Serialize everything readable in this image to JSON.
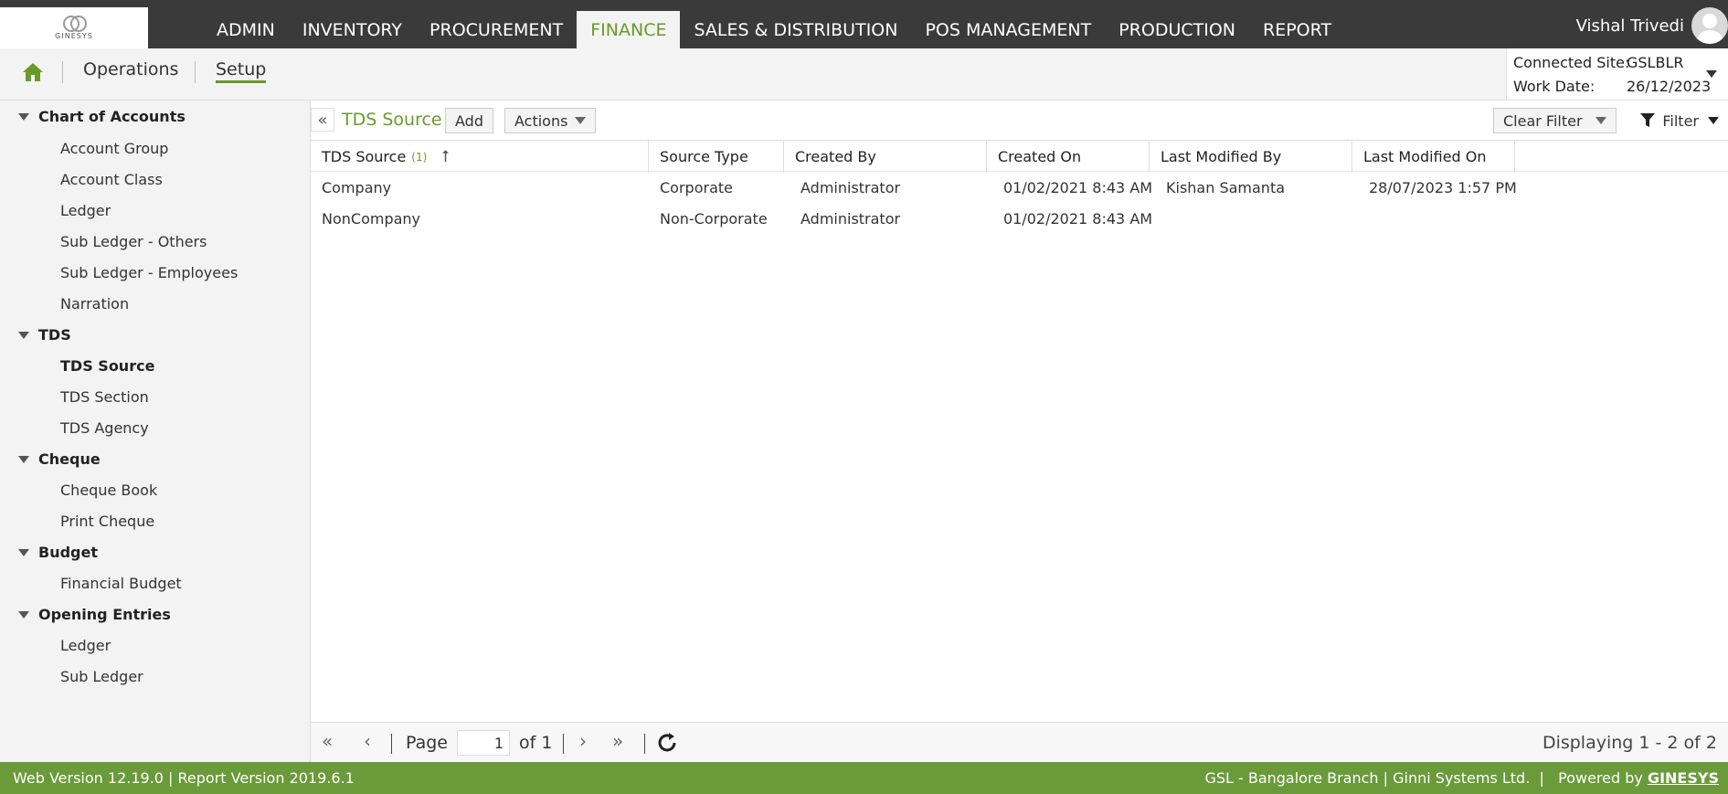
{
  "logo": {
    "text": "GINESYS"
  },
  "nav": {
    "items": [
      {
        "label": "ADMIN"
      },
      {
        "label": "INVENTORY"
      },
      {
        "label": "PROCUREMENT"
      },
      {
        "label": "FINANCE",
        "active": true
      },
      {
        "label": "SALES & DISTRIBUTION"
      },
      {
        "label": "POS MANAGEMENT"
      },
      {
        "label": "PRODUCTION"
      },
      {
        "label": "REPORT"
      }
    ]
  },
  "user": {
    "name": "Vishal Trivedi"
  },
  "subnav": {
    "operations": "Operations",
    "setup": "Setup"
  },
  "site": {
    "connected_label": "Connected Site:",
    "connected_value": "GSLBLR",
    "workdate_label": "Work Date:",
    "workdate_value": "26/12/2023"
  },
  "sidebar": {
    "groups": [
      {
        "label": "Chart of Accounts",
        "items": [
          "Account Group",
          "Account Class",
          "Ledger",
          "Sub Ledger - Others",
          "Sub Ledger - Employees",
          "Narration"
        ]
      },
      {
        "label": "TDS",
        "items": [
          "TDS Source",
          "TDS Section",
          "TDS Agency"
        ]
      },
      {
        "label": "Cheque",
        "items": [
          "Cheque Book",
          "Print Cheque"
        ]
      },
      {
        "label": "Budget",
        "items": [
          "Financial Budget"
        ]
      },
      {
        "label": "Opening Entries",
        "items": [
          "Ledger",
          "Sub Ledger"
        ]
      }
    ],
    "active_item": "TDS Source"
  },
  "toolbar": {
    "title": "TDS Source",
    "add_label": "Add",
    "actions_label": "Actions",
    "clear_filter_label": "Clear Filter",
    "filter_label": "Filter"
  },
  "grid": {
    "columns": [
      "TDS Source",
      "Source Type",
      "Created By",
      "Created On",
      "Last Modified By",
      "Last Modified On"
    ],
    "sort_count": "(1)",
    "rows": [
      [
        "Company",
        "Corporate",
        "Administrator",
        "01/02/2021 8:43 AM",
        "Kishan Samanta",
        "28/07/2023 1:57 PM"
      ],
      [
        "NonCompany",
        "Non-Corporate",
        "Administrator",
        "01/02/2021 8:43 AM",
        "",
        ""
      ]
    ]
  },
  "pager": {
    "page_label": "Page",
    "page_value": "1",
    "of_label": "of 1",
    "display_text": "Displaying 1 - 2 of 2"
  },
  "footer": {
    "left": "Web Version 12.19.0 | Report Version 2019.6.1",
    "right": "GSL - Bangalore Branch | Ginni Systems Ltd.  |   Powered by",
    "brand": "GINESYS"
  },
  "colors": {
    "accent": "#6a9a2a",
    "topbar": "#3a3a3a",
    "footer": "#6a9a3a"
  }
}
